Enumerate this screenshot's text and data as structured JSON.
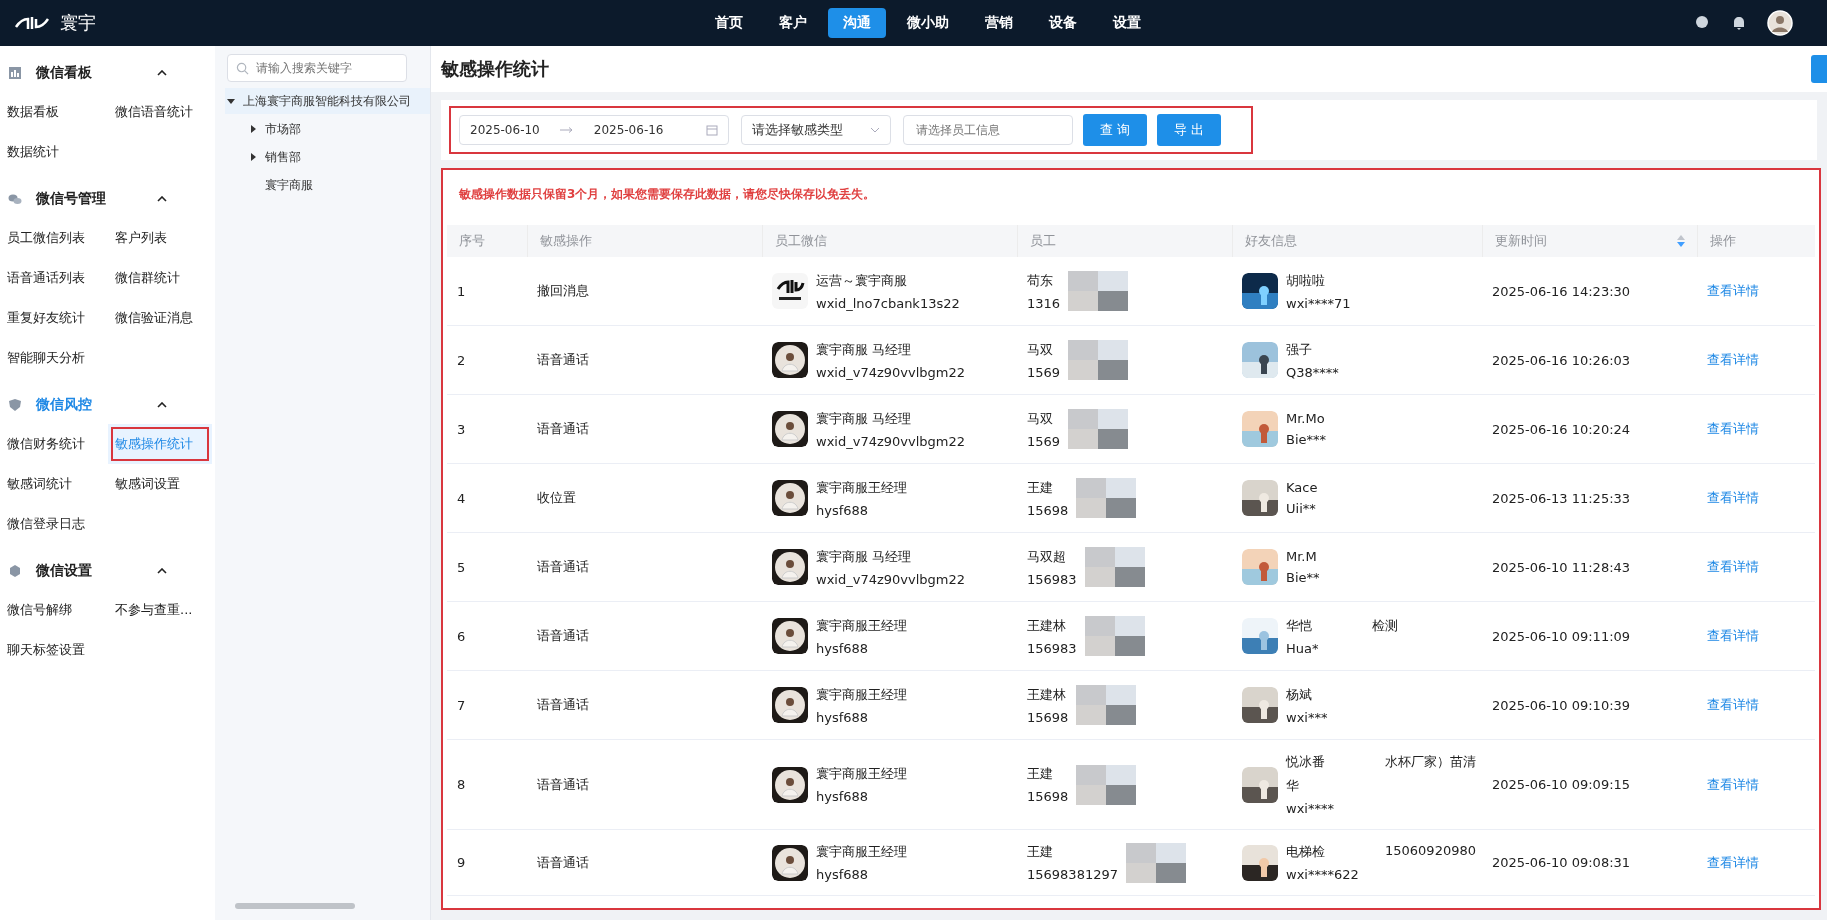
{
  "brand": {
    "name": "寰宇"
  },
  "nav": [
    {
      "label": "首页",
      "selected": false
    },
    {
      "label": "客户",
      "selected": false
    },
    {
      "label": "沟通",
      "selected": true
    },
    {
      "label": "微小助",
      "selected": false
    },
    {
      "label": "营销",
      "selected": false
    },
    {
      "label": "设备",
      "selected": false
    },
    {
      "label": "设置",
      "selected": false
    }
  ],
  "sidebar": [
    {
      "title": "微信看板",
      "expanded": true,
      "active": false,
      "items": [
        {
          "label": "数据看板",
          "selected": false
        },
        {
          "label": "微信语音统计",
          "selected": false
        },
        {
          "label": "数据统计",
          "selected": false
        }
      ]
    },
    {
      "title": "微信号管理",
      "expanded": true,
      "active": false,
      "items": [
        {
          "label": "员工微信列表",
          "selected": false
        },
        {
          "label": "客户列表",
          "selected": false
        },
        {
          "label": "语音通话列表",
          "selected": false
        },
        {
          "label": "微信群统计",
          "selected": false
        },
        {
          "label": "重复好友统计",
          "selected": false
        },
        {
          "label": "微信验证消息",
          "selected": false
        },
        {
          "label": "智能聊天分析",
          "selected": false
        }
      ]
    },
    {
      "title": "微信风控",
      "expanded": true,
      "active": true,
      "items": [
        {
          "label": "微信财务统计",
          "selected": false
        },
        {
          "label": "敏感操作统计",
          "selected": true
        },
        {
          "label": "敏感词统计",
          "selected": false
        },
        {
          "label": "敏感词设置",
          "selected": false
        },
        {
          "label": "微信登录日志",
          "selected": false
        }
      ]
    },
    {
      "title": "微信设置",
      "expanded": true,
      "active": false,
      "items": [
        {
          "label": "微信号解绑",
          "selected": false
        },
        {
          "label": "不参与查重...",
          "selected": false
        },
        {
          "label": "聊天标签设置",
          "selected": false
        }
      ]
    }
  ],
  "tree": {
    "search_placeholder": "请输入搜索关键字",
    "nodes": [
      {
        "label": "上海寰宇商服智能科技有限公司",
        "expanded": true,
        "selected": true,
        "children": [
          {
            "label": "市场部",
            "expanded": false,
            "selected": false
          },
          {
            "label": "销售部",
            "expanded": false,
            "selected": false
          },
          {
            "label": "寰宇商服",
            "selected": false
          }
        ]
      }
    ]
  },
  "page": {
    "title": "敏感操作统计"
  },
  "filters": {
    "date_start": "2025-06-10",
    "date_end": "2025-06-16",
    "type_placeholder": "请选择敏感类型",
    "employee_placeholder": "请选择员工信息",
    "buttons": [
      "查 询",
      "导 出"
    ]
  },
  "notice": "敏感操作数据只保留3个月，如果您需要保存此数据，请您尽快保存以免丢失。",
  "table": {
    "columns": [
      "序号",
      "敏感操作",
      "员工微信",
      "员工",
      "好友信息",
      "更新时间",
      "操作"
    ],
    "rows": [
      {
        "index": "1",
        "operation": "撤回消息",
        "employee": {
          "name": "运营～寰宇商服",
          "wxid": "wxid_lno7cbank13s22"
        },
        "info": {
          "name": "苟东",
          "phone": "1316"
        },
        "friend": {
          "name": [
            "胡啦啦"
          ],
          "id": "wxi****71"
        },
        "time": "2025-06-16 14:23:30",
        "action": "查看详情"
      },
      {
        "index": "2",
        "operation": "语音通话",
        "employee": {
          "name": "寰宇商服 马经理",
          "wxid": "wxid_v74z90vvlbgm22"
        },
        "info": {
          "name": "马双",
          "phone": "1569"
        },
        "friend": {
          "name": [
            "强子"
          ],
          "id": "Q38****"
        },
        "time": "2025-06-16 10:26:03",
        "action": "查看详情"
      },
      {
        "index": "3",
        "operation": "语音通话",
        "employee": {
          "name": "寰宇商服 马经理",
          "wxid": "wxid_v74z90vvlbgm22"
        },
        "info": {
          "name": "马双",
          "phone": "1569"
        },
        "friend": {
          "name": [
            "Mr.Mo"
          ],
          "id": "Bie***"
        },
        "time": "2025-06-16 10:20:24",
        "action": "查看详情"
      },
      {
        "index": "4",
        "operation": "收位置",
        "employee": {
          "name": "寰宇商服王经理",
          "wxid": "hysf688"
        },
        "info": {
          "name": "王建",
          "phone": "15698"
        },
        "friend": {
          "name": [
            "Kace"
          ],
          "id": "Uii**"
        },
        "time": "2025-06-13 11:25:33",
        "action": "查看详情"
      },
      {
        "index": "5",
        "operation": "语音通话",
        "employee": {
          "name": "寰宇商服 马经理",
          "wxid": "wxid_v74z90vvlbgm22"
        },
        "info": {
          "name": "马双超",
          "phone": "156983"
        },
        "friend": {
          "name": [
            "Mr.M"
          ],
          "id": "Bie**"
        },
        "time": "2025-06-10 11:28:43",
        "action": "查看详情"
      },
      {
        "index": "6",
        "operation": "语音通话",
        "employee": {
          "name": "寰宇商服王经理",
          "wxid": "hysf688"
        },
        "info": {
          "name": "王建林",
          "phone": "156983"
        },
        "friend": {
          "name": [
            "华恺",
            "检测"
          ],
          "id": "Hua*"
        },
        "time": "2025-06-10 09:11:09",
        "action": "查看详情"
      },
      {
        "index": "7",
        "operation": "语音通话",
        "employee": {
          "name": "寰宇商服王经理",
          "wxid": "hysf688"
        },
        "info": {
          "name": "王建林",
          "phone": "15698"
        },
        "friend": {
          "name": [
            "杨斌"
          ],
          "id": "wxi***"
        },
        "time": "2025-06-10 09:10:39",
        "action": "查看详情"
      },
      {
        "index": "8",
        "operation": "语音通话",
        "employee": {
          "name": "寰宇商服王经理",
          "wxid": "hysf688"
        },
        "info": {
          "name": "王建",
          "phone": "15698"
        },
        "friend": {
          "name": [
            "悦冰番",
            "水杯厂家）苗清"
          ],
          "name_wrap": "华",
          "id": "wxi****"
        },
        "time": "2025-06-10 09:09:15",
        "action": "查看详情"
      },
      {
        "index": "9",
        "operation": "语音通话",
        "employee": {
          "name": "寰宇商服王经理",
          "wxid": "hysf688"
        },
        "info": {
          "name": "王建",
          "phone": "15698381297"
        },
        "friend": {
          "name": [
            "电梯检",
            "15060920980"
          ],
          "id": "wxi****622"
        },
        "time": "2025-06-10 09:08:31",
        "action": "查看详情"
      }
    ]
  }
}
